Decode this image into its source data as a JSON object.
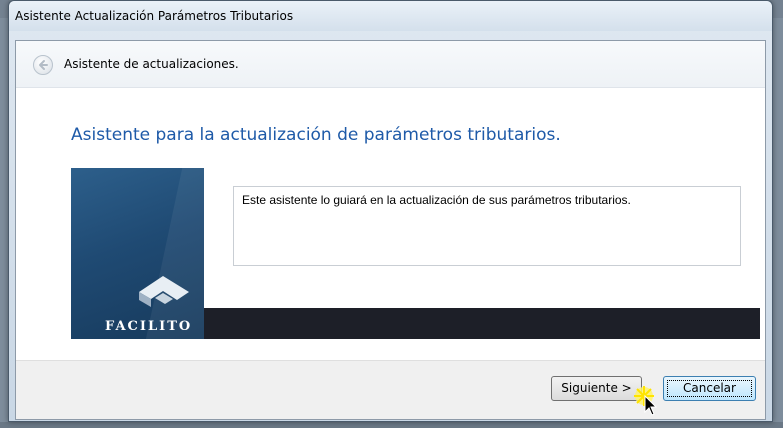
{
  "window": {
    "title": "Asistente Actualización Parámetros Tributarios"
  },
  "nav": {
    "title": "Asistente de actualizaciones.",
    "back_icon": "back-arrow-icon"
  },
  "main": {
    "heading": "Asistente para la actualización de parámetros tributarios.",
    "description": "Este asistente lo guiará en la actualización de sus parámetros tributarios.",
    "brand": "FACILITO"
  },
  "footer": {
    "next_label": "Siguiente >",
    "cancel_label": "Cancelar"
  },
  "colors": {
    "heading": "#1e5aa8",
    "banner_dark": "#1d1f28",
    "logo_panel": "#1f4a73"
  }
}
